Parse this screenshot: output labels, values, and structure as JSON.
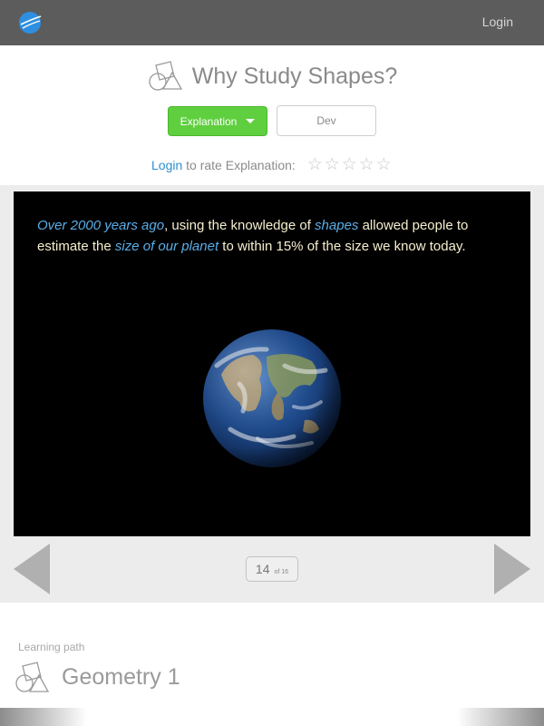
{
  "topbar": {
    "login_label": "Login"
  },
  "header": {
    "title": "Why Study Shapes?",
    "explanation_button": "Explanation",
    "dev_button": "Dev",
    "rate_login_link": "Login",
    "rate_text": " to rate Explanation:",
    "rating": {
      "filled": 0,
      "max": 5,
      "star_glyph": "☆"
    }
  },
  "slide": {
    "segments": [
      {
        "text": "Over 2000 years ago",
        "highlight": true
      },
      {
        "text": ", using the knowledge of ",
        "highlight": false
      },
      {
        "text": "shapes",
        "highlight": true
      },
      {
        "text": " allowed people to estimate the ",
        "highlight": false
      },
      {
        "text": "size of our planet",
        "highlight": true
      },
      {
        "text": " to within 15% of the size we know today.",
        "highlight": false
      }
    ],
    "image": "earth-globe"
  },
  "pager": {
    "current": "14",
    "total": "of 16"
  },
  "learning_path": {
    "label": "Learning path",
    "title": "Geometry 1"
  },
  "colors": {
    "accent_green": "#5fcf3f",
    "link_blue": "#2a8fd1",
    "highlight_blue": "#5aaee8",
    "slide_text": "#f5efcf",
    "topbar": "#5c5c5c"
  }
}
